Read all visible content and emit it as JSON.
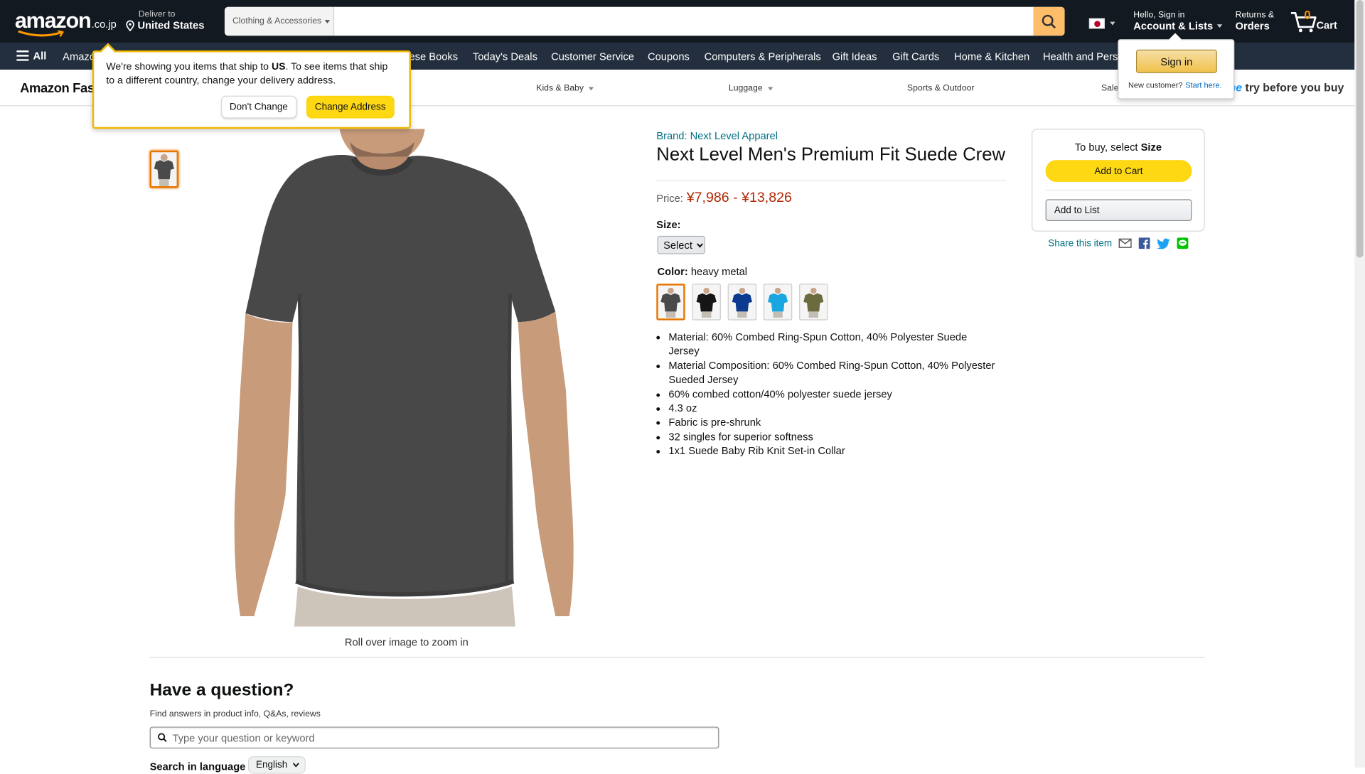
{
  "header": {
    "logo_word": "amazon",
    "logo_tld": ".co.jp",
    "deliver_label": "Deliver to",
    "deliver_location": "United States",
    "search_dept": "Clothing & Accessories",
    "search_placeholder": "",
    "account_greeting": "Hello, Sign in",
    "account_label": "Account & Lists",
    "returns_l1": "Returns &",
    "returns_l2": "Orders",
    "cart_count": "0",
    "cart_label": "Cart"
  },
  "subnav": {
    "all_label": "All",
    "items": [
      "Amazo",
      "ese Books",
      "Today's Deals",
      "Customer Service",
      "Coupons",
      "Computers & Peripherals",
      "Gift Ideas",
      "Gift Cards",
      "Home & Kitchen",
      "Health and Perso"
    ]
  },
  "fashion_bar": {
    "brand": "Amazon Fas",
    "categories": [
      "Kids & Baby",
      "Luggage",
      "Sports & Outdoor",
      "Sale"
    ],
    "tbyb_prime": "me",
    "tbyb_text": " try before you buy"
  },
  "popover": {
    "text_pre": "We're showing you items that ship to ",
    "text_country": "US",
    "text_post": ". To see items that ship to a different country, change your delivery address.",
    "dont_change": "Don't Change",
    "change_address": "Change Address"
  },
  "signin_flyout": {
    "button": "Sign in",
    "new_customer": "New customer?",
    "start_here": "Start here."
  },
  "product": {
    "brand": "Brand: Next Level Apparel",
    "title": "Next Level Men's Premium Fit Suede Crew",
    "price_label": "Price:",
    "price_range": "¥7,986 - ¥13,826",
    "size_label": "Size:",
    "size_selected": "Select",
    "color_label": "Color:",
    "color_value": "heavy metal",
    "swatch_colors": [
      "#4a4a4a",
      "#151515",
      "#0b3a8e",
      "#1aa6e0",
      "#6b6b3f"
    ],
    "bullets": [
      "Material: 60% Combed Ring-Spun Cotton, 40% Polyester Suede Jersey",
      "Material Composition: 60% Combed Ring-Spun Cotton, 40% Polyester Sueded Jersey",
      "60% combed cotton/40% polyester suede jersey",
      "4.3 oz",
      "Fabric is pre-shrunk",
      "32 singles for superior softness",
      "1x1 Suede Baby Rib Knit Set-in Collar"
    ],
    "rollover": "Roll over image to zoom in"
  },
  "buybox": {
    "to_buy_pre": "To buy, select ",
    "to_buy_bold": "Size",
    "add_to_cart": "Add to Cart",
    "add_to_list": "Add to List",
    "share": "Share this item"
  },
  "questions": {
    "title": "Have a question?",
    "subtitle": "Find answers in product info, Q&As, reviews",
    "placeholder": "Type your question or keyword",
    "lang_label": "Search in language",
    "lang_value": "English"
  },
  "colors": {
    "nav_dark": "#131921",
    "nav_sub": "#232f3e",
    "accent_orange": "#febd69",
    "price_red": "#b12704",
    "link_teal": "#007185",
    "cart_yellow": "#ffd814"
  }
}
